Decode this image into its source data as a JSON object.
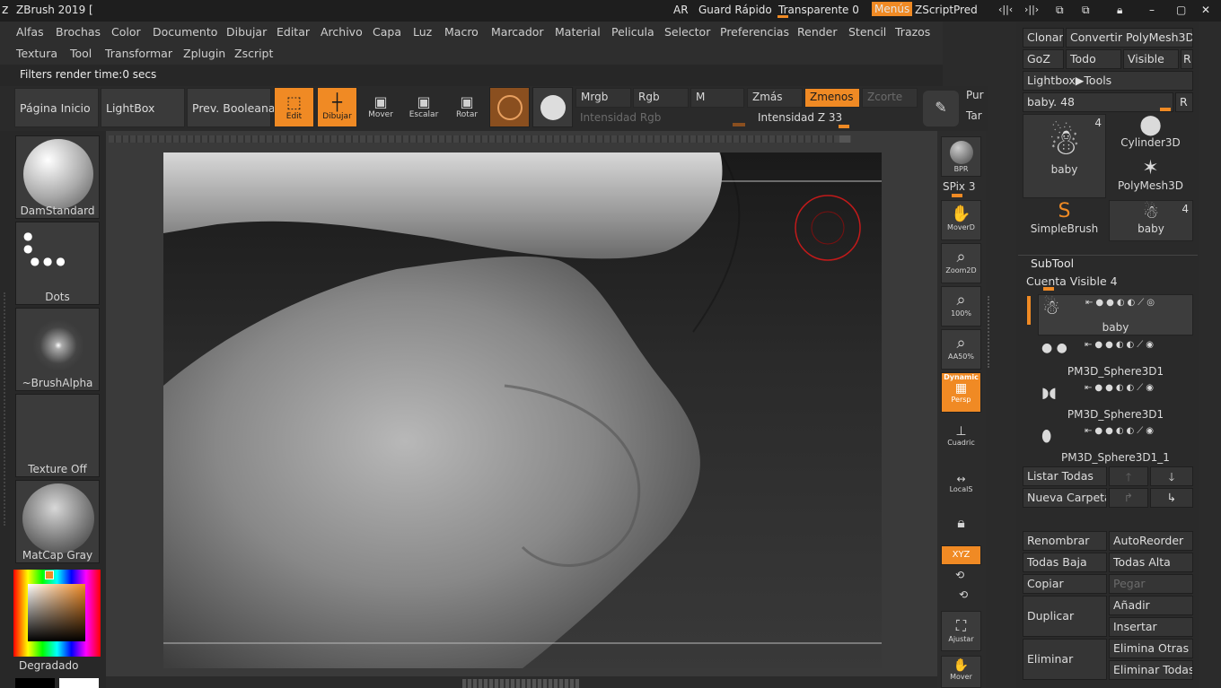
{
  "titlebar": {
    "app_title": "ZBrush 2019 [",
    "ar": "AR",
    "quicksave": "Guard Rápido",
    "transparent": "Transparente 0",
    "menus": "Menús",
    "zscript": "ZScriptPred"
  },
  "menu": {
    "row1": [
      "Alfas",
      "Brochas",
      "Color",
      "Documento",
      "Dibujar",
      "Editar",
      "Archivo",
      "Capa",
      "Luz",
      "Macro",
      "Marcador",
      "Material",
      "Pelicula",
      "Selector",
      "Preferencias",
      "Render",
      "Stencil",
      "Trazos"
    ],
    "row2": [
      "Textura",
      "Tool",
      "Transformar",
      "Zplugin",
      "Zscript"
    ]
  },
  "status": {
    "text": "Filters render time:0 secs"
  },
  "toolbar": {
    "home": "Página Inicio",
    "lightbox": "LightBox",
    "prev_boolean": "Prev. Booleana",
    "edit": "Edit",
    "draw": "Dibujar",
    "move": "Mover",
    "scale": "Escalar",
    "rotate": "Rotar",
    "mrgb": "Mrgb",
    "rgb": "Rgb",
    "m": "M",
    "zadd": "Zmás",
    "zsub": "Zmenos",
    "zcut": "Zcorte",
    "rgb_intensity": "Intensidad Rgb",
    "z_intensity": "Intensidad Z 33",
    "z_intensity_value": 33,
    "pur": "Pur",
    "tar": "Tar"
  },
  "left_shelf": {
    "brush": "DamStandard",
    "stroke": "Dots",
    "alpha": "~BrushAlpha",
    "texture": "Texture Off",
    "material": "MatCap Gray",
    "gradient": "Degradado"
  },
  "right_shelf": {
    "bpr": "BPR",
    "spix": "SPix 3",
    "moverd": "MoverD",
    "zoom2d": "Zoom2D",
    "p100": "100%",
    "aa50": "AA50%",
    "dynamic": "Dynamic",
    "persp": "Persp",
    "floor": "Cuadric",
    "local": "LocalS",
    "xyz": "XYZ",
    "frame": "Ajustar",
    "move": "Mover"
  },
  "tool_panel": {
    "clone": "Clonar",
    "make_polymesh": "Convertir PolyMesh3D",
    "goz": "GoZ",
    "all": "Todo",
    "visible": "Visible",
    "r": "R",
    "lightbox_tools": "Lightbox▶Tools",
    "current_tool": "baby. 48",
    "current_tool_value": 48,
    "tools": [
      {
        "name": "baby",
        "count": "4"
      },
      {
        "name": "Cylinder3D",
        "count": ""
      },
      {
        "name": "PolyMesh3D",
        "count": ""
      },
      {
        "name": "SimpleBrush",
        "count": ""
      },
      {
        "name": "baby",
        "count": "4"
      }
    ]
  },
  "subtool": {
    "header": "SubTool",
    "visible_count": "Cuenta Visible 4",
    "items": [
      "baby",
      "PM3D_Sphere3D1",
      "PM3D_Sphere3D1",
      "PM3D_Sphere3D1_1"
    ],
    "list_all": "Listar Todas",
    "new_folder": "Nueva Carpeta",
    "rename": "Renombrar",
    "autoreorder": "AutoReorder",
    "all_low": "Todas Baja",
    "all_high": "Todas Alta",
    "copy": "Copiar",
    "paste": "Pegar",
    "duplicate": "Duplicar",
    "append": "Añadir",
    "insert": "Insertar",
    "delete": "Eliminar",
    "delete_other": "Elimina Otras",
    "delete_all": "Eliminar Todas"
  }
}
